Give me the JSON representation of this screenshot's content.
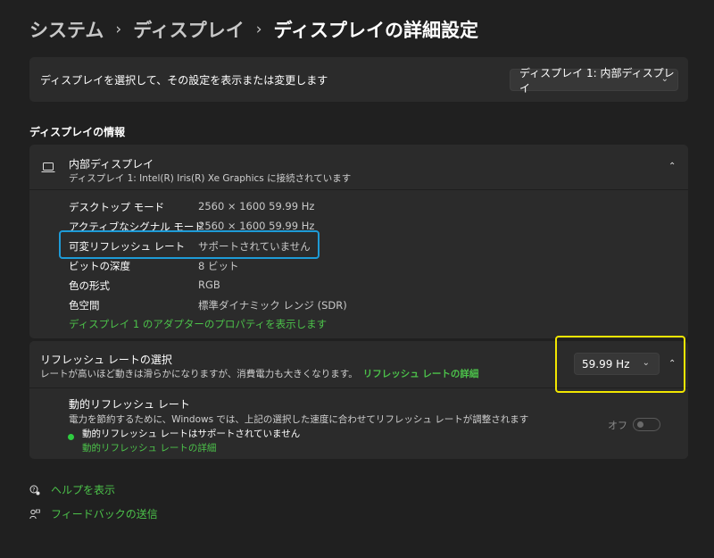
{
  "breadcrumb": {
    "items": [
      "システム",
      "ディスプレイ",
      "ディスプレイの詳細設定"
    ],
    "separator": "›"
  },
  "display_select": {
    "label": "ディスプレイを選択して、その設定を表示または変更します",
    "selected": "ディスプレイ 1: 内部ディスプレイ"
  },
  "section_title": "ディスプレイの情報",
  "display_info": {
    "title": "内部ディスプレイ",
    "subtitle": "ディスプレイ 1: Intel(R) Iris(R) Xe Graphics に接続されています",
    "rows": [
      {
        "key": "デスクトップ モード",
        "value": "2560 × 1600 59.99 Hz"
      },
      {
        "key": "アクティブなシグナル モード",
        "value": "2560 × 1600 59.99 Hz"
      },
      {
        "key": "可変リフレッシュ レート",
        "value": "サポートされていません"
      },
      {
        "key": "ビットの深度",
        "value": "8 ビット"
      },
      {
        "key": "色の形式",
        "value": "RGB"
      },
      {
        "key": "色空間",
        "value": "標準ダイナミック レンジ (SDR)"
      }
    ],
    "adapter_link": "ディスプレイ 1 のアダプターのプロパティを表示します"
  },
  "refresh": {
    "title": "リフレッシュ レートの選択",
    "description": "レートが高いほど動きは滑らかになりますが、消費電力も大きくなります。",
    "details_link": "リフレッシュ レートの詳細",
    "selected_rate": "59.99 Hz",
    "dynamic": {
      "title": "動的リフレッシュ レート",
      "description": "電力を節約するために、Windows では、上記の選択した速度に合わせてリフレッシュ レートが調整されます",
      "status": "動的リフレッシュ レートはサポートされていません",
      "details_link": "動的リフレッシュ レートの詳細",
      "toggle_label": "オフ",
      "toggle_on": false
    }
  },
  "footer": {
    "help": "ヘルプを表示",
    "feedback": "フィードバックの送信"
  },
  "colors": {
    "background": "#202020",
    "card": "#2b2b2b",
    "accent_link": "#4cc24a",
    "highlight_blue": "#1e9bd7",
    "highlight_yellow": "#f2e600"
  }
}
